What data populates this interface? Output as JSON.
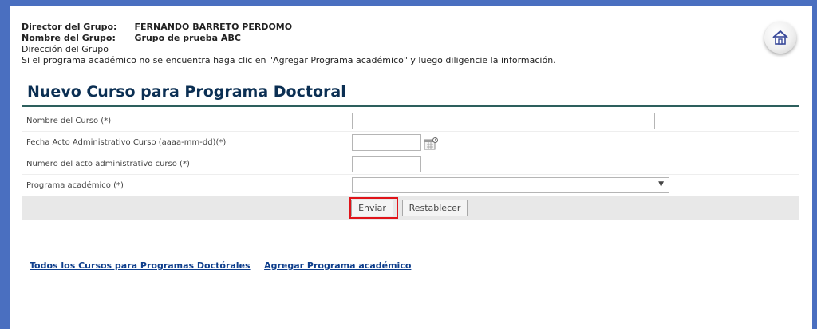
{
  "header": {
    "director_label": "Director del Grupo:",
    "director_value": "FERNANDO BARRETO PERDOMO",
    "group_label": "Nombre del Grupo:",
    "group_value": "Grupo de prueba ABC",
    "address_label": "Dirección del Grupo",
    "instruction": "Si el programa académico no se encuentra haga clic en \"Agregar Programa académico\" y luego diligencie la información."
  },
  "home_icon": "home-icon",
  "page_title": "Nuevo Curso para Programa Doctoral",
  "form": {
    "fields": [
      {
        "label": "Nombre del Curso (*)",
        "value": ""
      },
      {
        "label": "Fecha Acto Administrativo Curso (aaaa-mm-dd)(*)",
        "value": ""
      },
      {
        "label": "Numero del acto administrativo curso (*)",
        "value": ""
      },
      {
        "label": "Programa académico (*)",
        "value": ""
      }
    ],
    "calendar_icon": "calendar-icon",
    "submit_label": "Enviar",
    "reset_label": "Restablecer"
  },
  "links": {
    "all_courses": "Todos los Cursos para Programas Doctórales",
    "add_program": "Agregar Programa académico"
  },
  "colors": {
    "frame": "#4a6fc0",
    "title": "#0b2f53",
    "rule": "#2d5f5d",
    "highlight": "#e0141a",
    "link": "#0e3e8c"
  }
}
